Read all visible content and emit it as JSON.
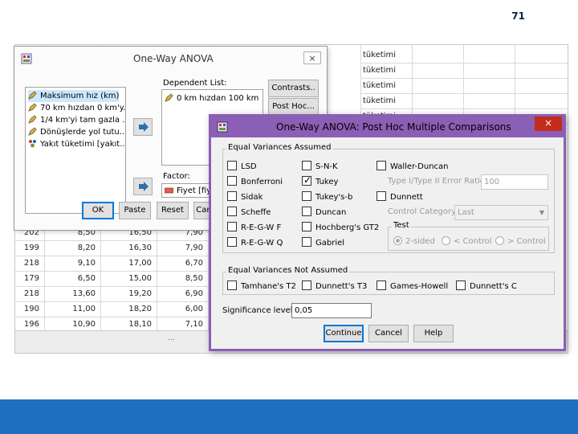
{
  "spreadsheet": {
    "right_column_text": "tüketimi",
    "rows": [
      [
        "202",
        "8,50",
        "16,50",
        "7,90"
      ],
      [
        "199",
        "8,20",
        "16,30",
        "7,90"
      ],
      [
        "218",
        "9,10",
        "17,00",
        "6,70"
      ],
      [
        "179",
        "6,50",
        "15,00",
        "8,50"
      ],
      [
        "218",
        "13,60",
        "19,20",
        "6,90"
      ],
      [
        "190",
        "11,00",
        "18,20",
        "6,00"
      ],
      [
        "196",
        "10,90",
        "18,10",
        "7,10"
      ]
    ],
    "footer_dots": "..."
  },
  "anova_dialog": {
    "title": "One-Way ANOVA",
    "close": "×",
    "source_variables": [
      {
        "label": "Maksimum hız (km)",
        "icon": "pencil-scale-icon",
        "selected": true
      },
      {
        "label": "70 km hızdan 0 km'y...",
        "icon": "pencil-scale-icon",
        "selected": false
      },
      {
        "label": "1/4 km'yi tam gazla ...",
        "icon": "pencil-scale-icon",
        "selected": false
      },
      {
        "label": "Dönüşlerde yol tutu...",
        "icon": "pencil-scale-icon",
        "selected": false
      },
      {
        "label": "Yakıt tüketimi [yakıt...",
        "icon": "nominal-people-icon",
        "selected": false
      }
    ],
    "dependent_list_label": "Dependent List:",
    "dependent_items": [
      "0 km hızdan 100 km"
    ],
    "factor_label": "Factor:",
    "factor_value": "Fiyet [fiy",
    "buttons": {
      "contrasts": "Contrasts..",
      "post_hoc": "Post Hoc...",
      "ok": "OK",
      "paste": "Paste",
      "reset": "Reset",
      "cancel": "Can"
    }
  },
  "posthoc_dialog": {
    "title": "One-Way ANOVA: Post Hoc Multiple Comparisons",
    "close": "×",
    "equal_assumed_label": "Equal Variances Assumed",
    "col1": [
      {
        "label": "LSD",
        "checked": false
      },
      {
        "label": "Bonferroni",
        "checked": false
      },
      {
        "label": "Sidak",
        "checked": false
      },
      {
        "label": "Scheffe",
        "checked": false
      },
      {
        "label": "R-E-G-W F",
        "checked": false
      },
      {
        "label": "R-E-G-W Q",
        "checked": false
      }
    ],
    "col2": [
      {
        "label": "S-N-K",
        "checked": false
      },
      {
        "label": "Tukey",
        "checked": true
      },
      {
        "label": "Tukey's-b",
        "checked": false
      },
      {
        "label": "Duncan",
        "checked": false
      },
      {
        "label": "Hochberg's GT2",
        "checked": false
      },
      {
        "label": "Gabriel",
        "checked": false
      }
    ],
    "waller_duncan": "Waller-Duncan",
    "error_ratio_label": "Type I/Type II Error Ratio:",
    "error_ratio_value": "100",
    "dunnett": "Dunnett",
    "control_category_label": "Control Category :",
    "control_category_value": "Last",
    "test_label": "Test",
    "test_options": [
      "2-sided",
      "< Control",
      "> Control"
    ],
    "not_assumed_label": "Equal Variances Not Assumed",
    "not_assumed": [
      "Tamhane's T2",
      "Dunnett's T3",
      "Games-Howell",
      "Dunnett's C"
    ],
    "significance_label": "Significance level:",
    "significance_value": "0,05",
    "buttons": {
      "continue": "Continue",
      "cancel": "Cancel",
      "help": "Help"
    }
  },
  "slide": {
    "page_number": "71"
  },
  "colors": {
    "posthoc_title_bar": "#8b5fb5",
    "close_red": "#c42b1c",
    "slide_bar": "#1f6fc0"
  }
}
